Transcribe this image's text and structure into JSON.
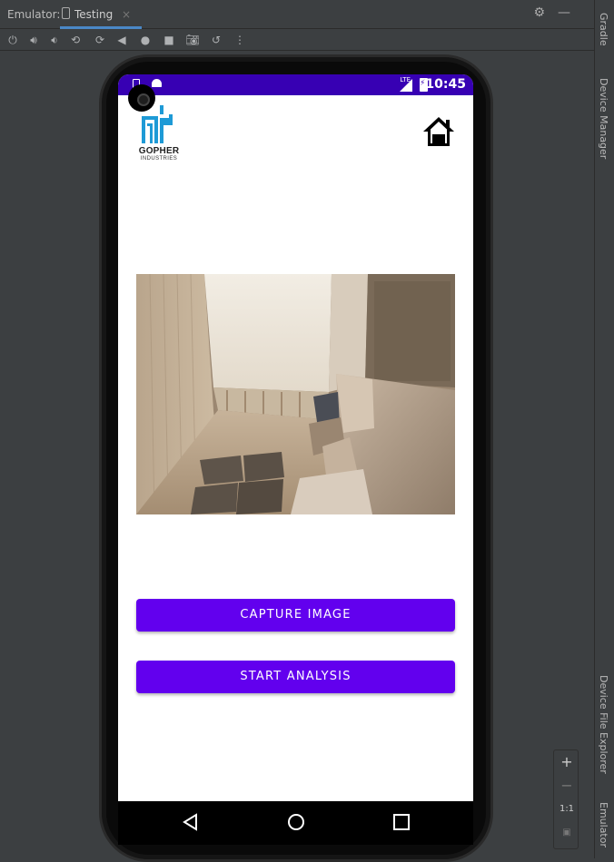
{
  "ide": {
    "emulator_label": "Emulator:",
    "tab_label": "Testing",
    "tab_close": "×",
    "side_tabs": [
      "Gradle",
      "Device Manager",
      "Device File Explorer",
      "Emulator"
    ],
    "zoom": {
      "plus": "+",
      "minus": "−",
      "one_to_one": "1:1"
    }
  },
  "device": {
    "status_bar": {
      "time": "10:45",
      "network": "LTE",
      "color": "#3700b3"
    }
  },
  "app": {
    "logo": {
      "line1": "GOPHER",
      "line2": "INDUSTRIES",
      "color": "#1e9ad6"
    },
    "home_icon": "home-icon",
    "buttons": {
      "capture": "CAPTURE IMAGE",
      "analysis": "START ANALYSIS"
    },
    "accent": "#6200ee"
  }
}
